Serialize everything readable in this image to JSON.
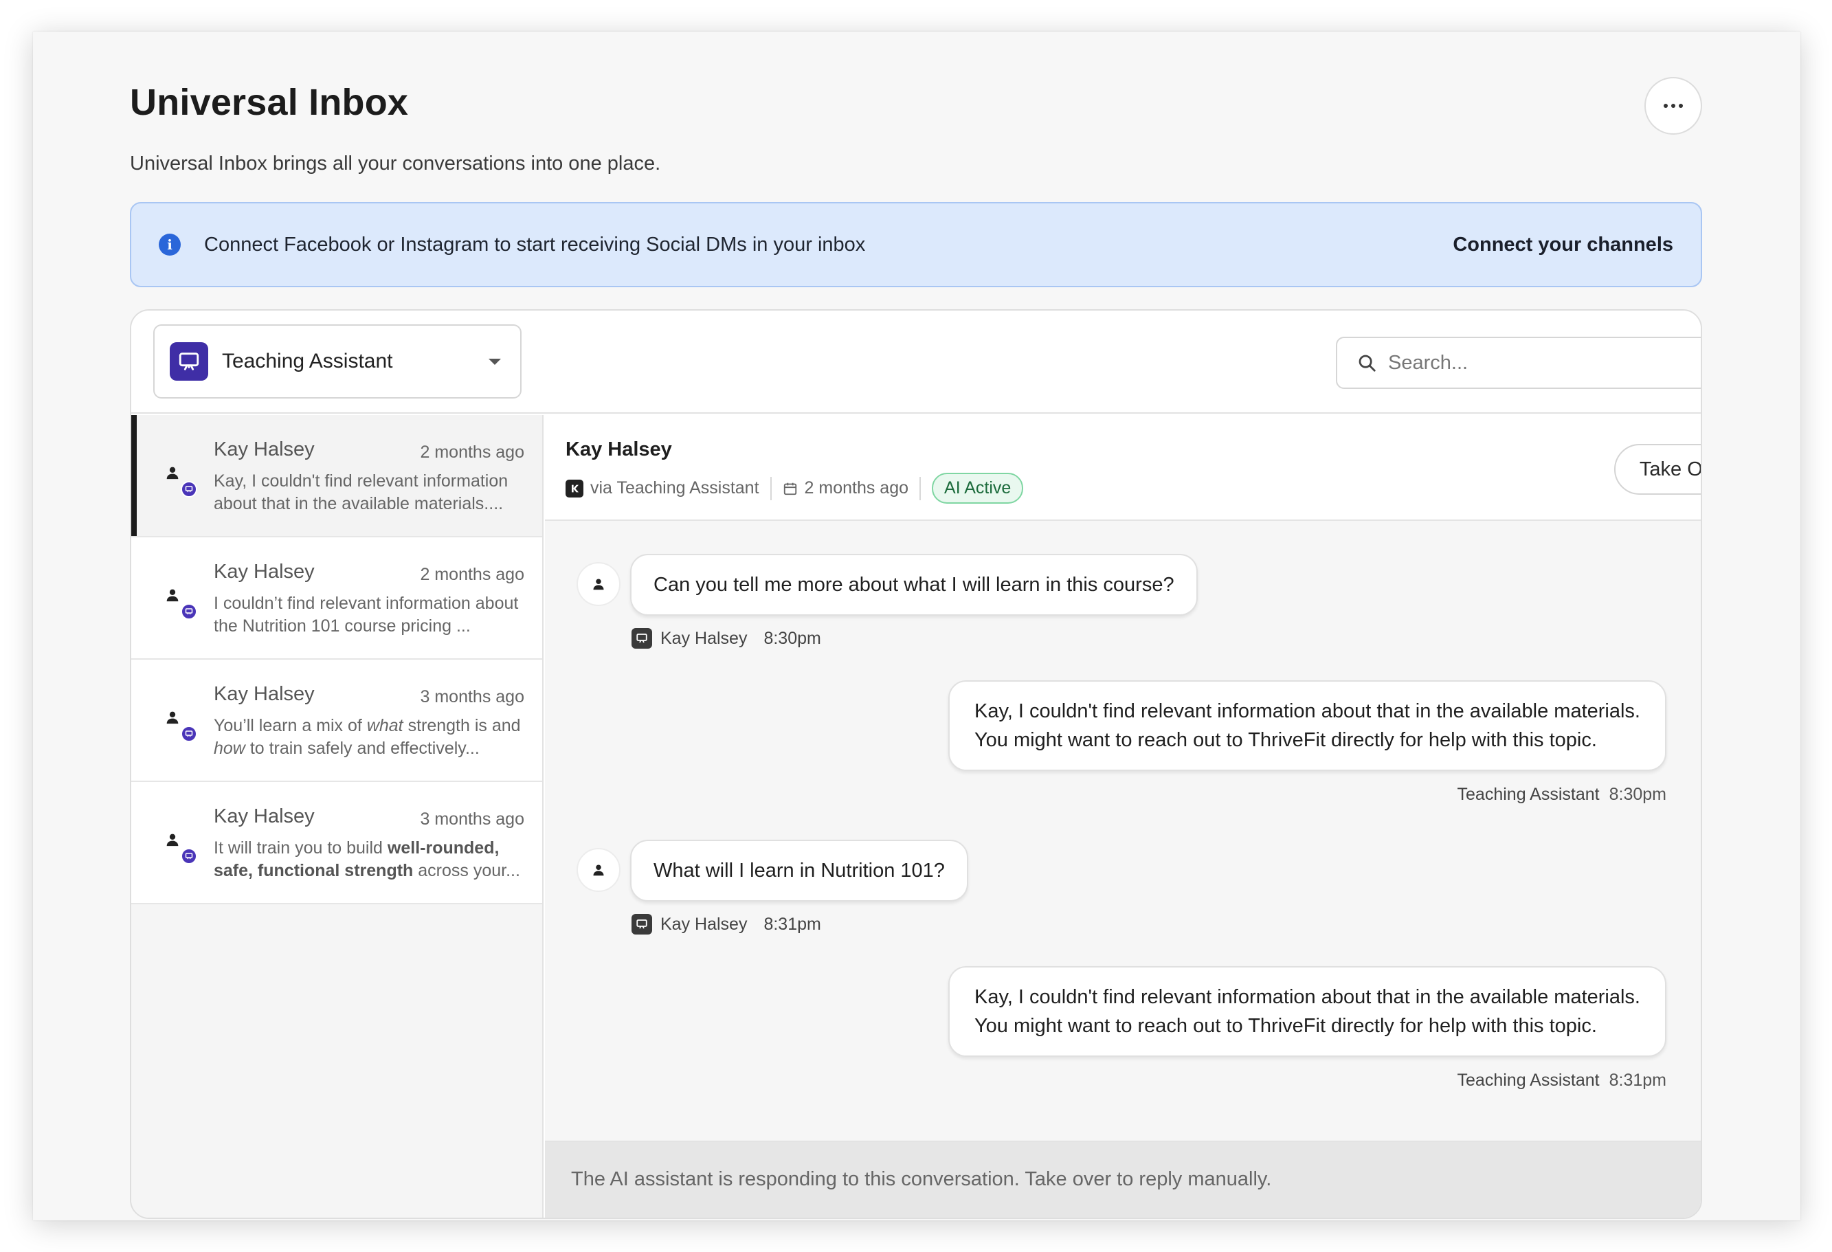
{
  "page": {
    "title": "Universal Inbox",
    "subtitle": "Universal Inbox brings all your conversations into one place.",
    "more_icon": "ellipsis-icon"
  },
  "banner": {
    "text": "Connect Facebook or Instagram to start receiving Social DMs in your inbox",
    "link": "Connect your channels",
    "color": "#dce9fc"
  },
  "assistant_select": {
    "label": "Teaching Assistant",
    "icon": "presentation-board-icon",
    "color": "#3f2ea6"
  },
  "search": {
    "placeholder": "Search..."
  },
  "conversations": [
    {
      "name": "Kay Halsey",
      "time": "2 months ago",
      "preview": "Kay, I couldn't find relevant information about that in the available materials....",
      "active": true
    },
    {
      "name": "Kay Halsey",
      "time": "2 months ago",
      "preview": "I couldn’t find relevant information about the Nutrition 101 course pricing ..."
    },
    {
      "name": "Kay Halsey",
      "time": "3 months ago",
      "preview_parts": [
        "You’ll learn a mix of ",
        "what",
        " strength is and ",
        "how",
        " to train safely and effectively..."
      ]
    },
    {
      "name": "Kay Halsey",
      "time": "3 months ago",
      "preview_parts": [
        "It will train you to build ",
        "well-rounded, safe, functional strength",
        " across your..."
      ]
    }
  ],
  "chat": {
    "header": {
      "name": "Kay Halsey",
      "via": "via Teaching Assistant",
      "time": "2 months ago",
      "status": "AI Active",
      "takeover": "Take Over"
    },
    "messages": [
      {
        "from": "user",
        "text": "Can you tell me more about what I will learn in this course?",
        "sender": "Kay Halsey",
        "time": "8:30pm"
      },
      {
        "from": "ai",
        "line1": "Kay, I couldn't find relevant information about that in the available materials.",
        "line2": "You might want to reach out to ThriveFit directly for help with this topic.",
        "sender": "Teaching Assistant",
        "time": "8:30pm"
      },
      {
        "from": "user",
        "text": "What will I learn in Nutrition 101?",
        "sender": "Kay Halsey",
        "time": "8:31pm"
      },
      {
        "from": "ai",
        "line1": "Kay, I couldn't find relevant information about that in the available materials.",
        "line2": "You might want to reach out to ThriveFit directly for help with this topic.",
        "sender": "Teaching Assistant",
        "time": "8:31pm"
      }
    ],
    "footer": "The AI assistant is responding to this conversation. Take over to reply manually."
  }
}
